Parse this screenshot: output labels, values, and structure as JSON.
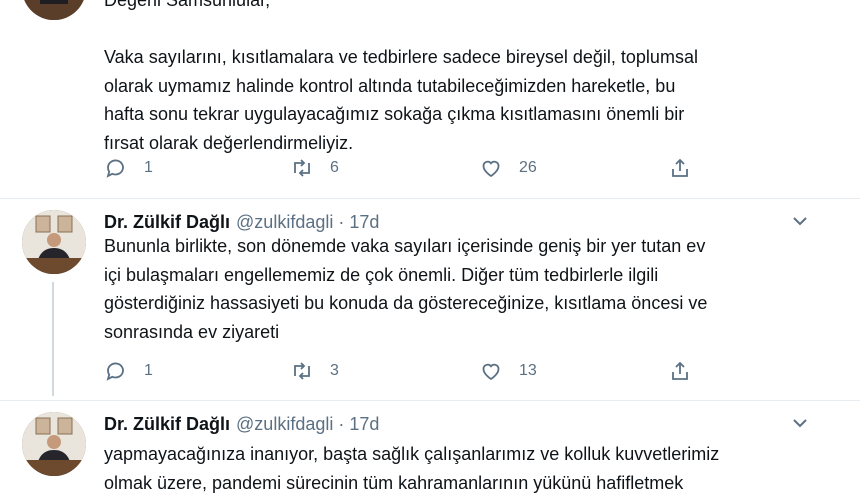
{
  "tweets": [
    {
      "lines": [
        "Değerli Samsunlular,",
        "",
        "Vaka sayılarını, kısıtlamalara ve tedbirlere sadece bireysel değil, toplumsal",
        "olarak uymamız halinde kontrol altında tutabileceğimizden hareketle, bu",
        "hafta sonu tekrar uygulayacağımız sokağa çıkma kısıtlamasını önemli bir",
        "fırsat olarak değerlendirmeliyiz."
      ],
      "replies": "1",
      "retweets": "6",
      "likes": "26"
    },
    {
      "name": "Dr. Zülkif Dağlı",
      "handle": "@zulkifdagli",
      "dot": "·",
      "time": "17d",
      "lines": [
        "Bununla birlikte, son dönemde vaka sayıları içerisinde geniş bir yer tutan ev",
        "içi bulaşmaları engellememiz de çok önemli. Diğer tüm tedbirlerle ilgili",
        "gösterdiğiniz hassasiyeti bu konuda da göstereceğinize, kısıtlama öncesi ve",
        "sonrasında ev ziyareti"
      ],
      "replies": "1",
      "retweets": "3",
      "likes": "13"
    },
    {
      "name": "Dr. Zülkif Dağlı",
      "handle": "@zulkifdagli",
      "dot": "·",
      "time": "17d",
      "lines": [
        "yapmayacağınıza inanıyor, başta sağlık çalışanlarımız ve kolluk kuvvetlerimiz",
        "olmak üzere, pandemi sürecinin tüm kahramanlarının yükünü hafifletmek"
      ]
    }
  ]
}
